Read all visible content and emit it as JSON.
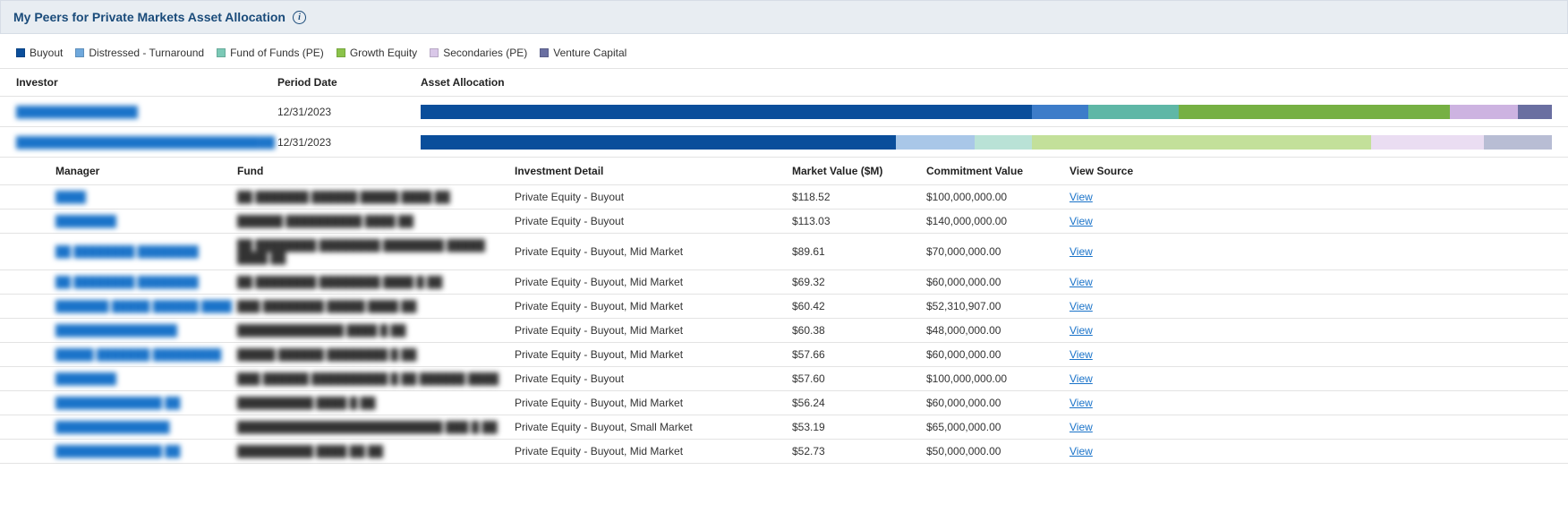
{
  "header": {
    "title": "My Peers for Private Markets Asset Allocation"
  },
  "legend": [
    {
      "label": "Buyout",
      "color": "#0a4e9b"
    },
    {
      "label": "Distressed - Turnaround",
      "color": "#6fa8dc"
    },
    {
      "label": "Fund of Funds (PE)",
      "color": "#7bc9b6"
    },
    {
      "label": "Growth Equity",
      "color": "#8bc34a"
    },
    {
      "label": "Secondaries (PE)",
      "color": "#d9c7e8"
    },
    {
      "label": "Venture Capital",
      "color": "#6a6fa1"
    }
  ],
  "columns": {
    "investor": "Investor",
    "period": "Period Date",
    "alloc": "Asset Allocation"
  },
  "peers": [
    {
      "investor": "████████████████",
      "period": "12/31/2023",
      "segments": [
        {
          "color": "#0a4e9b",
          "pct": 54
        },
        {
          "color": "#3d7cc9",
          "pct": 5
        },
        {
          "color": "#5fb7a6",
          "pct": 8
        },
        {
          "color": "#76b043",
          "pct": 24
        },
        {
          "color": "#cdb3e1",
          "pct": 6
        },
        {
          "color": "#6a6fa1",
          "pct": 3
        }
      ]
    },
    {
      "investor": "██████████████████████████████████",
      "period": "12/31/2023",
      "segments": [
        {
          "color": "#0a4e9b",
          "pct": 42
        },
        {
          "color": "#a9c7e8",
          "pct": 7
        },
        {
          "color": "#b9e2d6",
          "pct": 5
        },
        {
          "color": "#c3e09a",
          "pct": 30
        },
        {
          "color": "#eaddf2",
          "pct": 10
        },
        {
          "color": "#b8bdd4",
          "pct": 6
        }
      ]
    }
  ],
  "sub_columns": {
    "manager": "Manager",
    "fund": "Fund",
    "detail": "Investment Detail",
    "mv": "Market Value ($M)",
    "cv": "Commitment Value",
    "view": "View Source"
  },
  "view_label": "View",
  "rows": [
    {
      "manager": "████",
      "fund": "██ ███████ ██████ █████ ████ ██",
      "detail": "Private Equity - Buyout",
      "mv": "$118.52",
      "cv": "$100,000,000.00"
    },
    {
      "manager": "████████",
      "fund": "██████ ██████████ ████ ██",
      "detail": "Private Equity - Buyout",
      "mv": "$113.03",
      "cv": "$140,000,000.00"
    },
    {
      "manager": "██ ████████ ████████",
      "fund": "██ ████████ ████████ ████████ █████ ████ ██",
      "detail": "Private Equity - Buyout, Mid Market",
      "mv": "$89.61",
      "cv": "$70,000,000.00"
    },
    {
      "manager": "██ ████████ ████████",
      "fund": "██ ████████ ████████ ████ █ ██",
      "detail": "Private Equity - Buyout, Mid Market",
      "mv": "$69.32",
      "cv": "$60,000,000.00"
    },
    {
      "manager": "███████ █████ ██████ ████",
      "fund": "███ ████████ █████ ████ ██",
      "detail": "Private Equity - Buyout, Mid Market",
      "mv": "$60.42",
      "cv": "$52,310,907.00"
    },
    {
      "manager": "████████████████",
      "fund": "██████████████ ████ █ ██",
      "detail": "Private Equity - Buyout, Mid Market",
      "mv": "$60.38",
      "cv": "$48,000,000.00"
    },
    {
      "manager": "█████ ███████ █████████",
      "fund": "█████ ██████ ████████ █ ██",
      "detail": "Private Equity - Buyout, Mid Market",
      "mv": "$57.66",
      "cv": "$60,000,000.00"
    },
    {
      "manager": "████████",
      "fund": "███ ██████ ██████████ █ ██ ██████ ████",
      "detail": "Private Equity - Buyout",
      "mv": "$57.60",
      "cv": "$100,000,000.00"
    },
    {
      "manager": "██████████████ ██",
      "fund": "██████████ ████ █ ██",
      "detail": "Private Equity - Buyout, Mid Market",
      "mv": "$56.24",
      "cv": "$60,000,000.00"
    },
    {
      "manager": "███████████████",
      "fund": "███████████████████████████ ███ █ ██",
      "detail": "Private Equity - Buyout, Small Market",
      "mv": "$53.19",
      "cv": "$65,000,000.00"
    },
    {
      "manager": "██████████████ ██",
      "fund": "██████████ ████ ██ ██",
      "detail": "Private Equity - Buyout, Mid Market",
      "mv": "$52.73",
      "cv": "$50,000,000.00"
    }
  ],
  "chart_data": {
    "type": "bar",
    "title": "My Peers for Private Markets Asset Allocation",
    "xlabel": "Asset Allocation (%)",
    "ylabel": "Investor",
    "categories": [
      "Peer 1 (12/31/2023)",
      "Peer 2 (12/31/2023)"
    ],
    "series": [
      {
        "name": "Buyout",
        "values": [
          54,
          42
        ]
      },
      {
        "name": "Distressed - Turnaround",
        "values": [
          5,
          7
        ]
      },
      {
        "name": "Fund of Funds (PE)",
        "values": [
          8,
          5
        ]
      },
      {
        "name": "Growth Equity",
        "values": [
          24,
          30
        ]
      },
      {
        "name": "Secondaries (PE)",
        "values": [
          6,
          10
        ]
      },
      {
        "name": "Venture Capital",
        "values": [
          3,
          6
        ]
      }
    ],
    "xlim": [
      0,
      100
    ]
  }
}
